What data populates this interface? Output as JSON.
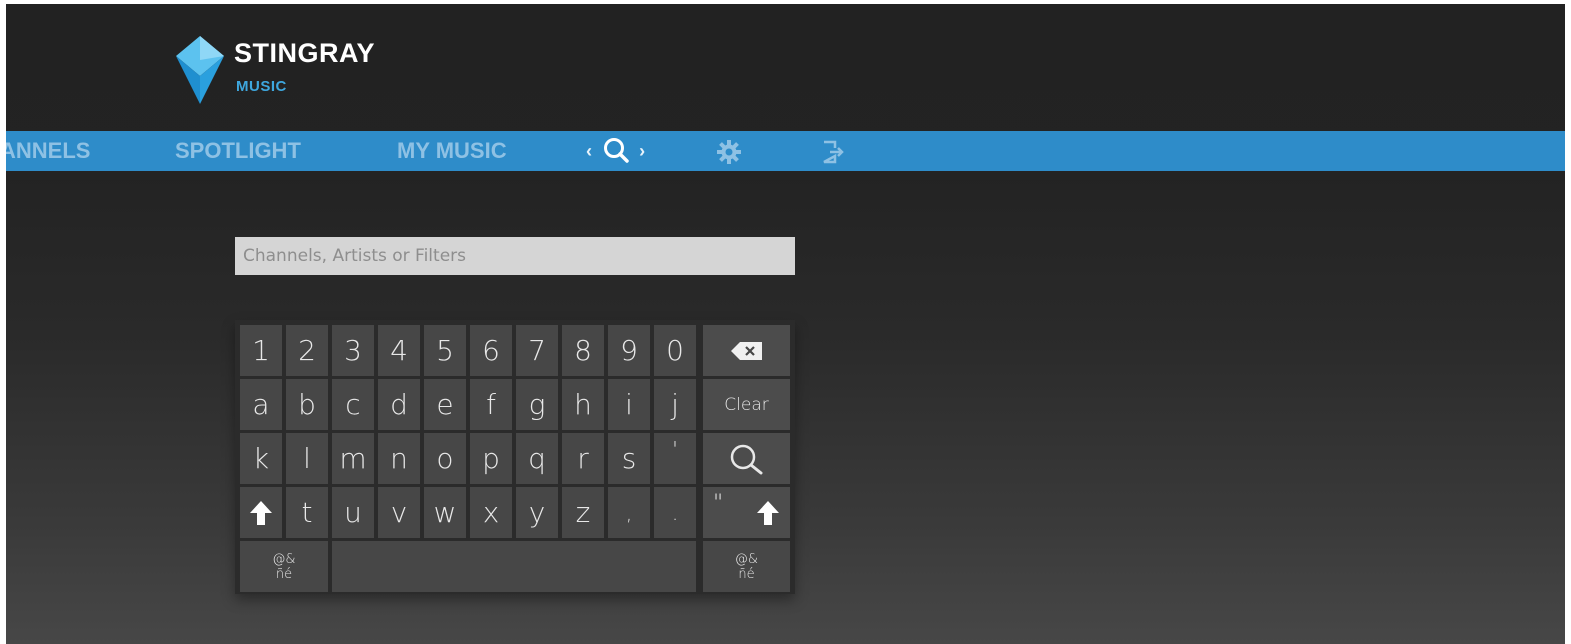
{
  "brand": {
    "name": "STINGRAY",
    "sub": "MUSIC",
    "colors": {
      "accent": "#3ea7de",
      "bar": "#2e8cc9"
    }
  },
  "nav": {
    "items": [
      {
        "label": "ANNELS"
      },
      {
        "label": "SPOTLIGHT"
      },
      {
        "label": "MY MUSIC"
      }
    ],
    "search": {
      "left": "‹",
      "right": "›",
      "icon": "search-icon"
    },
    "settings_icon": "gear-icon",
    "logout_icon": "logout-icon"
  },
  "search": {
    "placeholder": "Channels, Artists or Filters",
    "value": ""
  },
  "keyboard": {
    "row1": [
      "1",
      "2",
      "3",
      "4",
      "5",
      "6",
      "7",
      "8",
      "9",
      "0"
    ],
    "row2": [
      "a",
      "b",
      "c",
      "d",
      "e",
      "f",
      "g",
      "h",
      "i",
      "j"
    ],
    "row3": [
      "k",
      "l",
      "m",
      "n",
      "o",
      "p",
      "q",
      "r",
      "s",
      "'"
    ],
    "row4": [
      "t",
      "u",
      "v",
      "w",
      "x",
      "y",
      "z",
      ",",
      "."
    ],
    "backspace_icon": "backspace-icon",
    "clear_label": "Clear",
    "search_icon": "search-icon",
    "shift_icon": "shift-arrow-icon",
    "quote_label": "\"",
    "symbols_top": "@&",
    "symbols_bottom": "ñé",
    "space_label": ""
  }
}
